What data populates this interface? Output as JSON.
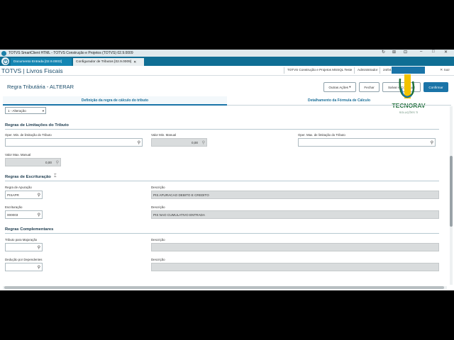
{
  "window": {
    "title": "TOTVS SmartClient HTML - TOTVS Construção e Projetos (TOTVS) 02.9.0009",
    "controls": [
      "↻",
      "⊞",
      "⊡",
      "–",
      "□",
      "✕"
    ]
  },
  "tabs": [
    {
      "label": "Documento Entrada [02.9.0003]"
    },
    {
      "label": "Configurador de Tributos [02.9.0009]",
      "close": "✕"
    }
  ],
  "header": {
    "app_title": "TOTVS | Livros Fiscais",
    "environment": "TOTVS Construção e Projetos MSSQL Teste",
    "user": "Administrador",
    "date": "24/04",
    "exit_label": "Sair"
  },
  "page": {
    "title": "Regra Tributária - ALTERAR"
  },
  "toolbar": {
    "other_actions_label": "Outras Ações",
    "close_label": "Fechar",
    "save_continue_label": "Salvar e Continuar",
    "confirm_label": "Confirmar"
  },
  "logo": {
    "brand": "TECNORAV",
    "tagline": "SOLUÇÕES TI"
  },
  "subtabs": [
    {
      "label": "Definição da regra de cálculo do tributo",
      "active": true
    },
    {
      "label": "Detalhamento da Fórmula de Cálculo",
      "active": false
    }
  ],
  "combo": {
    "value": "1 - Alteração"
  },
  "limits": {
    "title": "Regras de Limitações do Tributo",
    "min_oper_label": "Oper. Min. de limitação do Tributo",
    "min_value_label": "Valor Min. Manual",
    "min_value": "0,00",
    "max_oper_label": "Oper. Max. de limitação do Tributo",
    "max_value_label": "Valor Max. Manual",
    "max_value": "0,00"
  },
  "bookkeeping": {
    "title": "Regras de Escrituração",
    "apuracao_label": "Regra de Apuração",
    "apuracao_value": "PISAPR",
    "apuracao_desc_label": "Descrição",
    "apuracao_desc": "PIS APURACAO DEBITO E CREDITO",
    "escrit_label": "Escrituração",
    "escrit_value": "000003",
    "escrit_desc_label": "Descrição",
    "escrit_desc": "PIS NAO CUMULATIVO ENTRADA"
  },
  "complementary": {
    "title": "Regras Complementares",
    "majoracao_label": "Tributo para Majoração",
    "majoracao_desc_label": "Descrição",
    "dependentes_label": "Dedução por Dependentes",
    "dependentes_desc_label": "Descrição"
  },
  "colors": {
    "accent": "#1a74a8",
    "tabbar": "#0f6e94",
    "readonly": "#d9dcdd"
  }
}
